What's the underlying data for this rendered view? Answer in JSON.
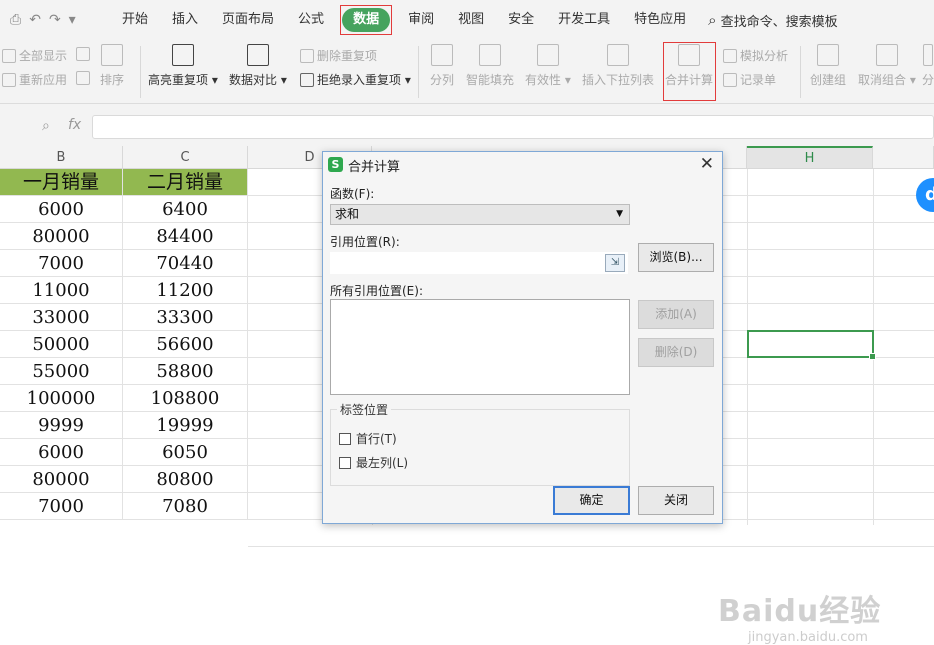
{
  "menubar": {
    "items": [
      "开始",
      "插入",
      "页面布局",
      "公式",
      "数据",
      "审阅",
      "视图",
      "安全",
      "开发工具",
      "特色应用"
    ],
    "active": "数据",
    "search_label": "查找命令、搜索模板"
  },
  "ribbon": {
    "show_all": "全部显示",
    "reapply": "重新应用",
    "sort": "排序",
    "highlight_dup": "高亮重复项",
    "data_compare": "数据对比",
    "delete_dup": "删除重复项",
    "reject_dup": "拒绝录入重复项",
    "split": "分列",
    "smart_fill": "智能填充",
    "validity": "有效性",
    "insert_dropdown": "插入下拉列表",
    "consolidate": "合并计算",
    "simulate": "模拟分析",
    "record": "记录单",
    "create_group": "创建组",
    "ungroup": "取消组合",
    "more": "分"
  },
  "formula_bar": {
    "fx": "fx"
  },
  "sheet": {
    "col_headers": [
      "B",
      "C",
      "D",
      "H"
    ],
    "header_row": [
      "一月销量",
      "二月销量"
    ],
    "rows": [
      [
        "6000",
        "6400"
      ],
      [
        "80000",
        "84400"
      ],
      [
        "7000",
        "70440"
      ],
      [
        "11000",
        "11200"
      ],
      [
        "33000",
        "33300"
      ],
      [
        "50000",
        "56600"
      ],
      [
        "55000",
        "58800"
      ],
      [
        "100000",
        "108800"
      ],
      [
        "9999",
        "19999"
      ],
      [
        "6000",
        "6050"
      ],
      [
        "80000",
        "80800"
      ],
      [
        "7000",
        "7080"
      ]
    ],
    "float_btn": "d",
    "watermark": "Baidu经验",
    "watermark_sub": "jingyan.baidu.com"
  },
  "dialog": {
    "logo": "S",
    "title": "合并计算",
    "function_label": "函数(F):",
    "function_value": "求和",
    "ref_label": "引用位置(R):",
    "browse": "浏览(B)...",
    "all_refs_label": "所有引用位置(E):",
    "add": "添加(A)",
    "delete": "删除(D)",
    "label_group": "标签位置",
    "first_row": "首行(T)",
    "left_col": "最左列(L)",
    "ok": "确定",
    "close": "关闭"
  }
}
